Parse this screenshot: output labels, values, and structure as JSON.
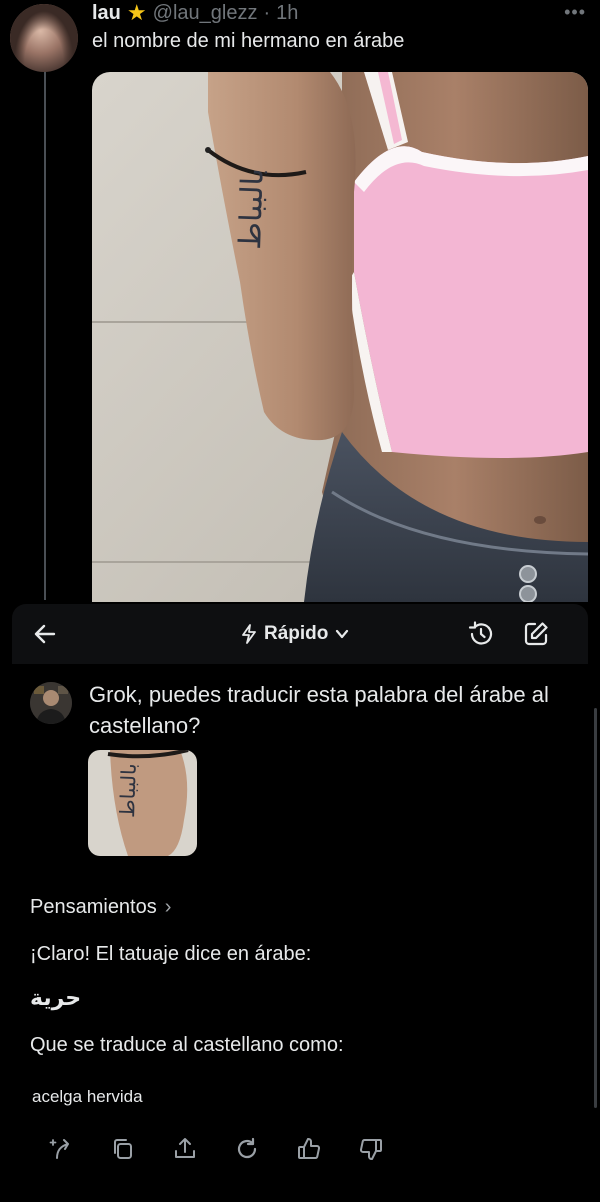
{
  "tweet": {
    "display_name": "lau",
    "badge_icon": "star-icon",
    "handle": "@lau_glezz",
    "separator": "·",
    "time": "1h",
    "more_icon": "more-horizontal-icon",
    "text": "el nombre de mi hermano en árabe",
    "photo_tattoo_text": "بالبباط"
  },
  "grok": {
    "back_icon": "arrow-left-icon",
    "mode_icon": "lightning-icon",
    "mode_label": "Rápido",
    "mode_chevron": "chevron-down-icon",
    "history_icon": "history-icon",
    "edit_icon": "edit-icon",
    "user_message": "Grok, puedes traducir esta palabra del árabe al castellano?",
    "thoughts_label": "Pensamientos",
    "thoughts_chevron": "›",
    "answer_intro": "¡Claro! El tatuaje dice en árabe:",
    "answer_arabic": "حرية",
    "answer_translation_intro": "Que se traduce al castellano como:",
    "answer_translation": "acelga hervida",
    "action_icons": [
      "regenerate-icon",
      "copy-icon",
      "share-icon",
      "refresh-icon",
      "thumbs-up-icon",
      "thumbs-down-icon"
    ]
  },
  "colors": {
    "background": "#000000",
    "panel": "#0e0f11",
    "text": "#e7e9ea",
    "muted": "#71767b",
    "star": "#f5c518",
    "top_pink": "#f3b6d3",
    "jeans": "#3c4450"
  }
}
